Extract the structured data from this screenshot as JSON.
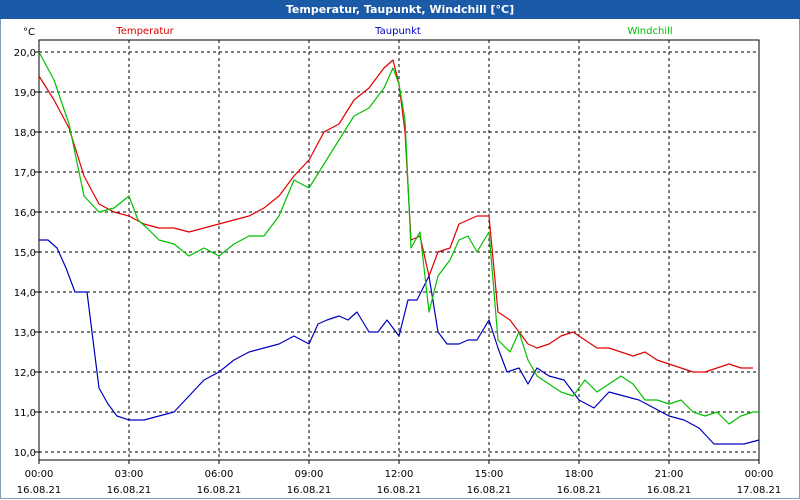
{
  "window": {
    "title": "Temperatur, Taupunkt, Windchill [°C]"
  },
  "colors": {
    "titlebar": "#1b5aa6",
    "temperatur": "#e00000",
    "taupunkt": "#0000c0",
    "windchill": "#00c000"
  },
  "chart_data": {
    "type": "line",
    "title": "Temperatur, Taupunkt, Windchill [°C]",
    "ylabel": "°C",
    "ylim": [
      9.8,
      20.3
    ],
    "xlim": [
      0,
      24
    ],
    "grid": true,
    "legend_placement": "top",
    "y_ticks": [
      "10,0",
      "11,0",
      "12,0",
      "13,0",
      "14,0",
      "15,0",
      "16,0",
      "17,0",
      "18,0",
      "19,0",
      "20,0"
    ],
    "y_tick_values": [
      10,
      11,
      12,
      13,
      14,
      15,
      16,
      17,
      18,
      19,
      20
    ],
    "x_ticks": [
      {
        "time": "00:00",
        "date": "16.08.21"
      },
      {
        "time": "03:00",
        "date": "16.08.21"
      },
      {
        "time": "06:00",
        "date": "16.08.21"
      },
      {
        "time": "09:00",
        "date": "16.08.21"
      },
      {
        "time": "12:00",
        "date": "16.08.21"
      },
      {
        "time": "15:00",
        "date": "16.08.21"
      },
      {
        "time": "18:00",
        "date": "16.08.21"
      },
      {
        "time": "21:00",
        "date": "16.08.21"
      },
      {
        "time": "00:00",
        "date": "17.08.21"
      }
    ],
    "x_tick_values": [
      0,
      3,
      6,
      9,
      12,
      15,
      18,
      21,
      24
    ],
    "series": [
      {
        "name": "Temperatur",
        "color": "#e00000",
        "x": [
          0,
          0.5,
          1,
          1.5,
          2,
          2.5,
          3,
          3.5,
          4,
          4.5,
          5,
          5.5,
          6,
          6.5,
          7,
          7.5,
          8,
          8.5,
          9,
          9.5,
          10,
          10.5,
          11,
          11.5,
          11.8,
          12,
          12.2,
          12.4,
          12.7,
          13,
          13.3,
          13.7,
          14,
          14.3,
          14.6,
          15,
          15.3,
          15.7,
          16,
          16.3,
          16.6,
          17,
          17.4,
          17.8,
          18.2,
          18.6,
          19,
          19.4,
          19.8,
          20.2,
          20.6,
          21,
          21.4,
          21.8,
          22.2,
          22.6,
          23,
          23.4,
          23.8
        ],
        "values": [
          19.4,
          18.8,
          18.1,
          16.9,
          16.2,
          16.0,
          15.9,
          15.7,
          15.6,
          15.6,
          15.5,
          15.6,
          15.7,
          15.8,
          15.9,
          16.1,
          16.4,
          16.9,
          17.3,
          18.0,
          18.2,
          18.8,
          19.1,
          19.6,
          19.8,
          19.2,
          18.0,
          15.3,
          15.4,
          14.4,
          15.0,
          15.1,
          15.7,
          15.8,
          15.9,
          15.9,
          13.5,
          13.3,
          13.0,
          12.7,
          12.6,
          12.7,
          12.9,
          13.0,
          12.8,
          12.6,
          12.6,
          12.5,
          12.4,
          12.5,
          12.3,
          12.2,
          12.1,
          12.0,
          12.0,
          12.1,
          12.2,
          12.1,
          12.1
        ]
      },
      {
        "name": "Taupunkt",
        "color": "#0000c0",
        "x": [
          0,
          0.3,
          0.6,
          0.9,
          1.2,
          1.6,
          2,
          2.3,
          2.6,
          3,
          3.5,
          4,
          4.5,
          5,
          5.5,
          6,
          6.5,
          7,
          7.5,
          8,
          8.5,
          9,
          9.3,
          9.6,
          10,
          10.3,
          10.6,
          11,
          11.3,
          11.6,
          12,
          12.3,
          12.6,
          13,
          13.3,
          13.6,
          14,
          14.3,
          14.6,
          15,
          15.3,
          15.6,
          16,
          16.3,
          16.6,
          17,
          17.5,
          18,
          18.5,
          19,
          19.5,
          20,
          20.5,
          21,
          21.5,
          22,
          22.5,
          23,
          23.5,
          24
        ],
        "values": [
          15.3,
          15.3,
          15.1,
          14.6,
          14.0,
          14.0,
          11.6,
          11.2,
          10.9,
          10.8,
          10.8,
          10.9,
          11.0,
          11.4,
          11.8,
          12.0,
          12.3,
          12.5,
          12.6,
          12.7,
          12.9,
          12.7,
          13.2,
          13.3,
          13.4,
          13.3,
          13.5,
          13.0,
          13.0,
          13.3,
          12.9,
          13.8,
          13.8,
          14.4,
          13.0,
          12.7,
          12.7,
          12.8,
          12.8,
          13.3,
          12.6,
          12.0,
          12.1,
          11.7,
          12.1,
          11.9,
          11.8,
          11.3,
          11.1,
          11.5,
          11.4,
          11.3,
          11.1,
          10.9,
          10.8,
          10.6,
          10.2,
          10.2,
          10.2,
          10.3
        ]
      },
      {
        "name": "Windchill",
        "color": "#00c000",
        "x": [
          0,
          0.5,
          1,
          1.5,
          2,
          2.5,
          3,
          3.3,
          3.6,
          4,
          4.5,
          5,
          5.5,
          6,
          6.5,
          7,
          7.5,
          8,
          8.5,
          9,
          9.5,
          10,
          10.5,
          11,
          11.5,
          11.8,
          12,
          12.2,
          12.4,
          12.7,
          13,
          13.3,
          13.7,
          14,
          14.3,
          14.6,
          15,
          15.3,
          15.7,
          16,
          16.3,
          16.6,
          17,
          17.4,
          17.8,
          18.2,
          18.6,
          19,
          19.4,
          19.8,
          20.2,
          20.6,
          21,
          21.4,
          21.8,
          22.2,
          22.6,
          23,
          23.4,
          23.8,
          24
        ],
        "values": [
          20.0,
          19.3,
          18.2,
          16.4,
          16.0,
          16.1,
          16.4,
          15.8,
          15.6,
          15.3,
          15.2,
          14.9,
          15.1,
          14.9,
          15.2,
          15.4,
          15.4,
          15.9,
          16.8,
          16.6,
          17.2,
          17.8,
          18.4,
          18.6,
          19.1,
          19.6,
          19.2,
          18.3,
          15.1,
          15.5,
          13.5,
          14.4,
          14.8,
          15.3,
          15.4,
          15.0,
          15.5,
          12.8,
          12.5,
          13.0,
          12.3,
          11.9,
          11.7,
          11.5,
          11.4,
          11.8,
          11.5,
          11.7,
          11.9,
          11.7,
          11.3,
          11.3,
          11.2,
          11.3,
          11.0,
          10.9,
          11.0,
          10.7,
          10.9,
          11.0,
          11.0
        ]
      }
    ]
  }
}
